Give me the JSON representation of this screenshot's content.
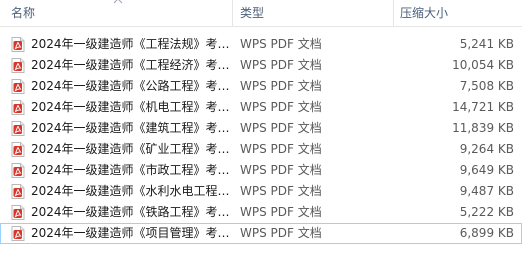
{
  "columns": {
    "name": "名称",
    "type": "类型",
    "size": "压缩大小"
  },
  "files": [
    {
      "name": "2024年一级建造师《工程法规》考…",
      "type": "WPS PDF 文档",
      "size": "5,241 KB",
      "icon": "wps-pdf-icon"
    },
    {
      "name": "2024年一级建造师《工程经济》考…",
      "type": "WPS PDF 文档",
      "size": "10,054 KB",
      "icon": "wps-pdf-icon"
    },
    {
      "name": "2024年一级建造师《公路工程》考…",
      "type": "WPS PDF 文档",
      "size": "7,508 KB",
      "icon": "wps-pdf-icon"
    },
    {
      "name": "2024年一级建造师《机电工程》考…",
      "type": "WPS PDF 文档",
      "size": "14,721 KB",
      "icon": "wps-pdf-icon"
    },
    {
      "name": "2024年一级建造师《建筑工程》考…",
      "type": "WPS PDF 文档",
      "size": "11,839 KB",
      "icon": "wps-pdf-icon"
    },
    {
      "name": "2024年一级建造师《矿业工程》考…",
      "type": "WPS PDF 文档",
      "size": "9,264 KB",
      "icon": "wps-pdf-icon"
    },
    {
      "name": "2024年一级建造师《市政工程》考…",
      "type": "WPS PDF 文档",
      "size": "9,649 KB",
      "icon": "wps-pdf-icon"
    },
    {
      "name": "2024年一级建造师《水利水电工程…",
      "type": "WPS PDF 文档",
      "size": "9,487 KB",
      "icon": "wps-pdf-icon"
    },
    {
      "name": "2024年一级建造师《铁路工程》考…",
      "type": "WPS PDF 文档",
      "size": "5,222 KB",
      "icon": "wps-pdf-icon"
    },
    {
      "name": "2024年一级建造师《项目管理》考…",
      "type": "WPS PDF 文档",
      "size": "6,899 KB",
      "icon": "wps-pdf-icon"
    }
  ],
  "selected_row": 9,
  "colors": {
    "header_text": "#4c607a",
    "icon_red": "#d9352b",
    "selection_border": "#99d1ff"
  }
}
